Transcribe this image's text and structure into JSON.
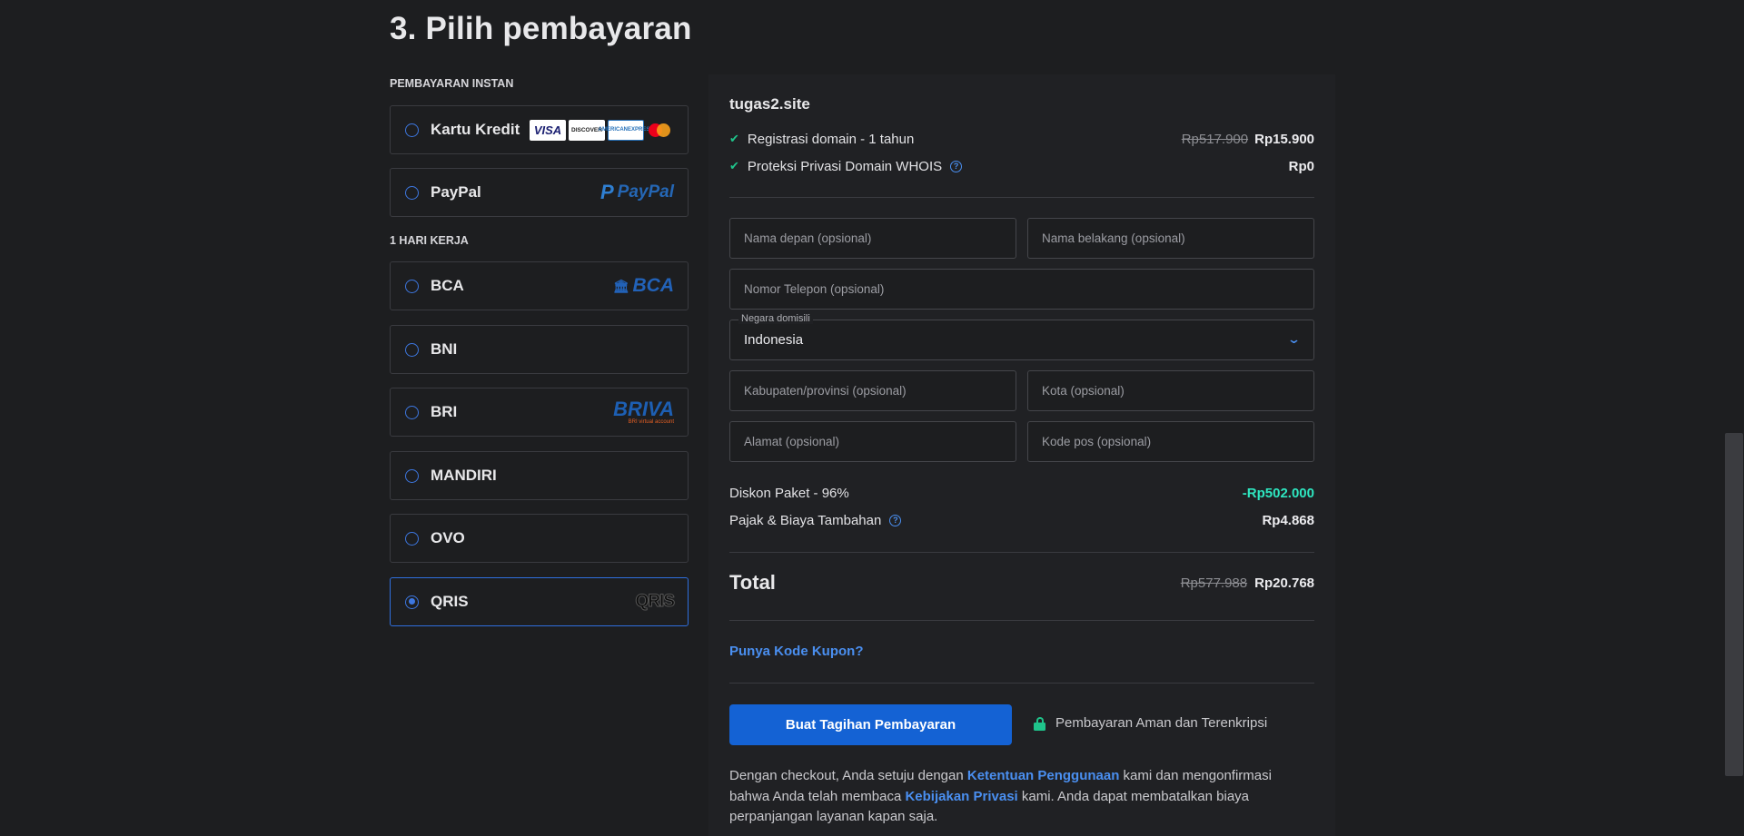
{
  "page": {
    "title": "3. Pilih pembayaran"
  },
  "payment": {
    "section_instan": "PEMBAYARAN INSTAN",
    "section_hari": "1 HARI KERJA",
    "options": [
      {
        "label": "Kartu Kredit",
        "selected": false
      },
      {
        "label": "PayPal",
        "selected": false
      },
      {
        "label": "BCA",
        "selected": false
      },
      {
        "label": "BNI",
        "selected": false
      },
      {
        "label": "BRI",
        "selected": false
      },
      {
        "label": "MANDIRI",
        "selected": false
      },
      {
        "label": "OVO",
        "selected": false
      },
      {
        "label": "QRIS",
        "selected": true
      }
    ],
    "logos": {
      "visa": "VISA",
      "discover": "DISCOVER",
      "amex_1": "AMERICAN",
      "amex_2": "EXPRESS",
      "paypal": "PayPal",
      "paypal_mark": "P",
      "bca": "BCA",
      "briva": "BRIVA",
      "briva_sub": "BRI virtual account",
      "qris": "QRIS"
    }
  },
  "summary": {
    "domain": "tugas2.site",
    "items": [
      {
        "label": "Registrasi domain - 1 tahun",
        "old_price": "Rp517.900",
        "price": "Rp15.900"
      },
      {
        "label": "Proteksi Privasi Domain WHOIS",
        "price": "Rp0"
      }
    ],
    "form": {
      "first_name_placeholder": "Nama depan (opsional)",
      "last_name_placeholder": "Nama belakang (opsional)",
      "phone_placeholder": "Nomor Telepon (opsional)",
      "country_label": "Negara domisili",
      "country_value": "Indonesia",
      "province_placeholder": "Kabupaten/provinsi (opsional)",
      "city_placeholder": "Kota (opsional)",
      "address_placeholder": "Alamat (opsional)",
      "postal_placeholder": "Kode pos (opsional)"
    },
    "discount_label": "Diskon Paket - 96%",
    "discount_value": "-Rp502.000",
    "tax_label": "Pajak & Biaya Tambahan",
    "tax_value": "Rp4.868",
    "total_label": "Total",
    "total_old": "Rp577.988",
    "total_new": "Rp20.768",
    "coupon_link": "Punya Kode Kupon?",
    "pay_button": "Buat Tagihan Pembayaran",
    "secure_text": "Pembayaran Aman dan Terenkripsi",
    "terms": {
      "part1": "Dengan checkout, Anda setuju dengan ",
      "link1": "Ketentuan Penggunaan",
      "part2": " kami dan mengonfirmasi bahwa Anda telah membaca ",
      "link2": "Kebijakan Privasi",
      "part3": " kami. Anda dapat membatalkan biaya perpanjangan layanan kapan saja."
    }
  },
  "icons": {
    "check": "check-icon",
    "help": "question-circle-icon",
    "chevron": "chevron-down-icon",
    "lock": "lock-icon"
  },
  "colors": {
    "accent": "#1462d4",
    "link": "#4a8ff0",
    "success": "#1fc48b",
    "discount": "#2ee6c0",
    "background": "#1d1e20"
  }
}
